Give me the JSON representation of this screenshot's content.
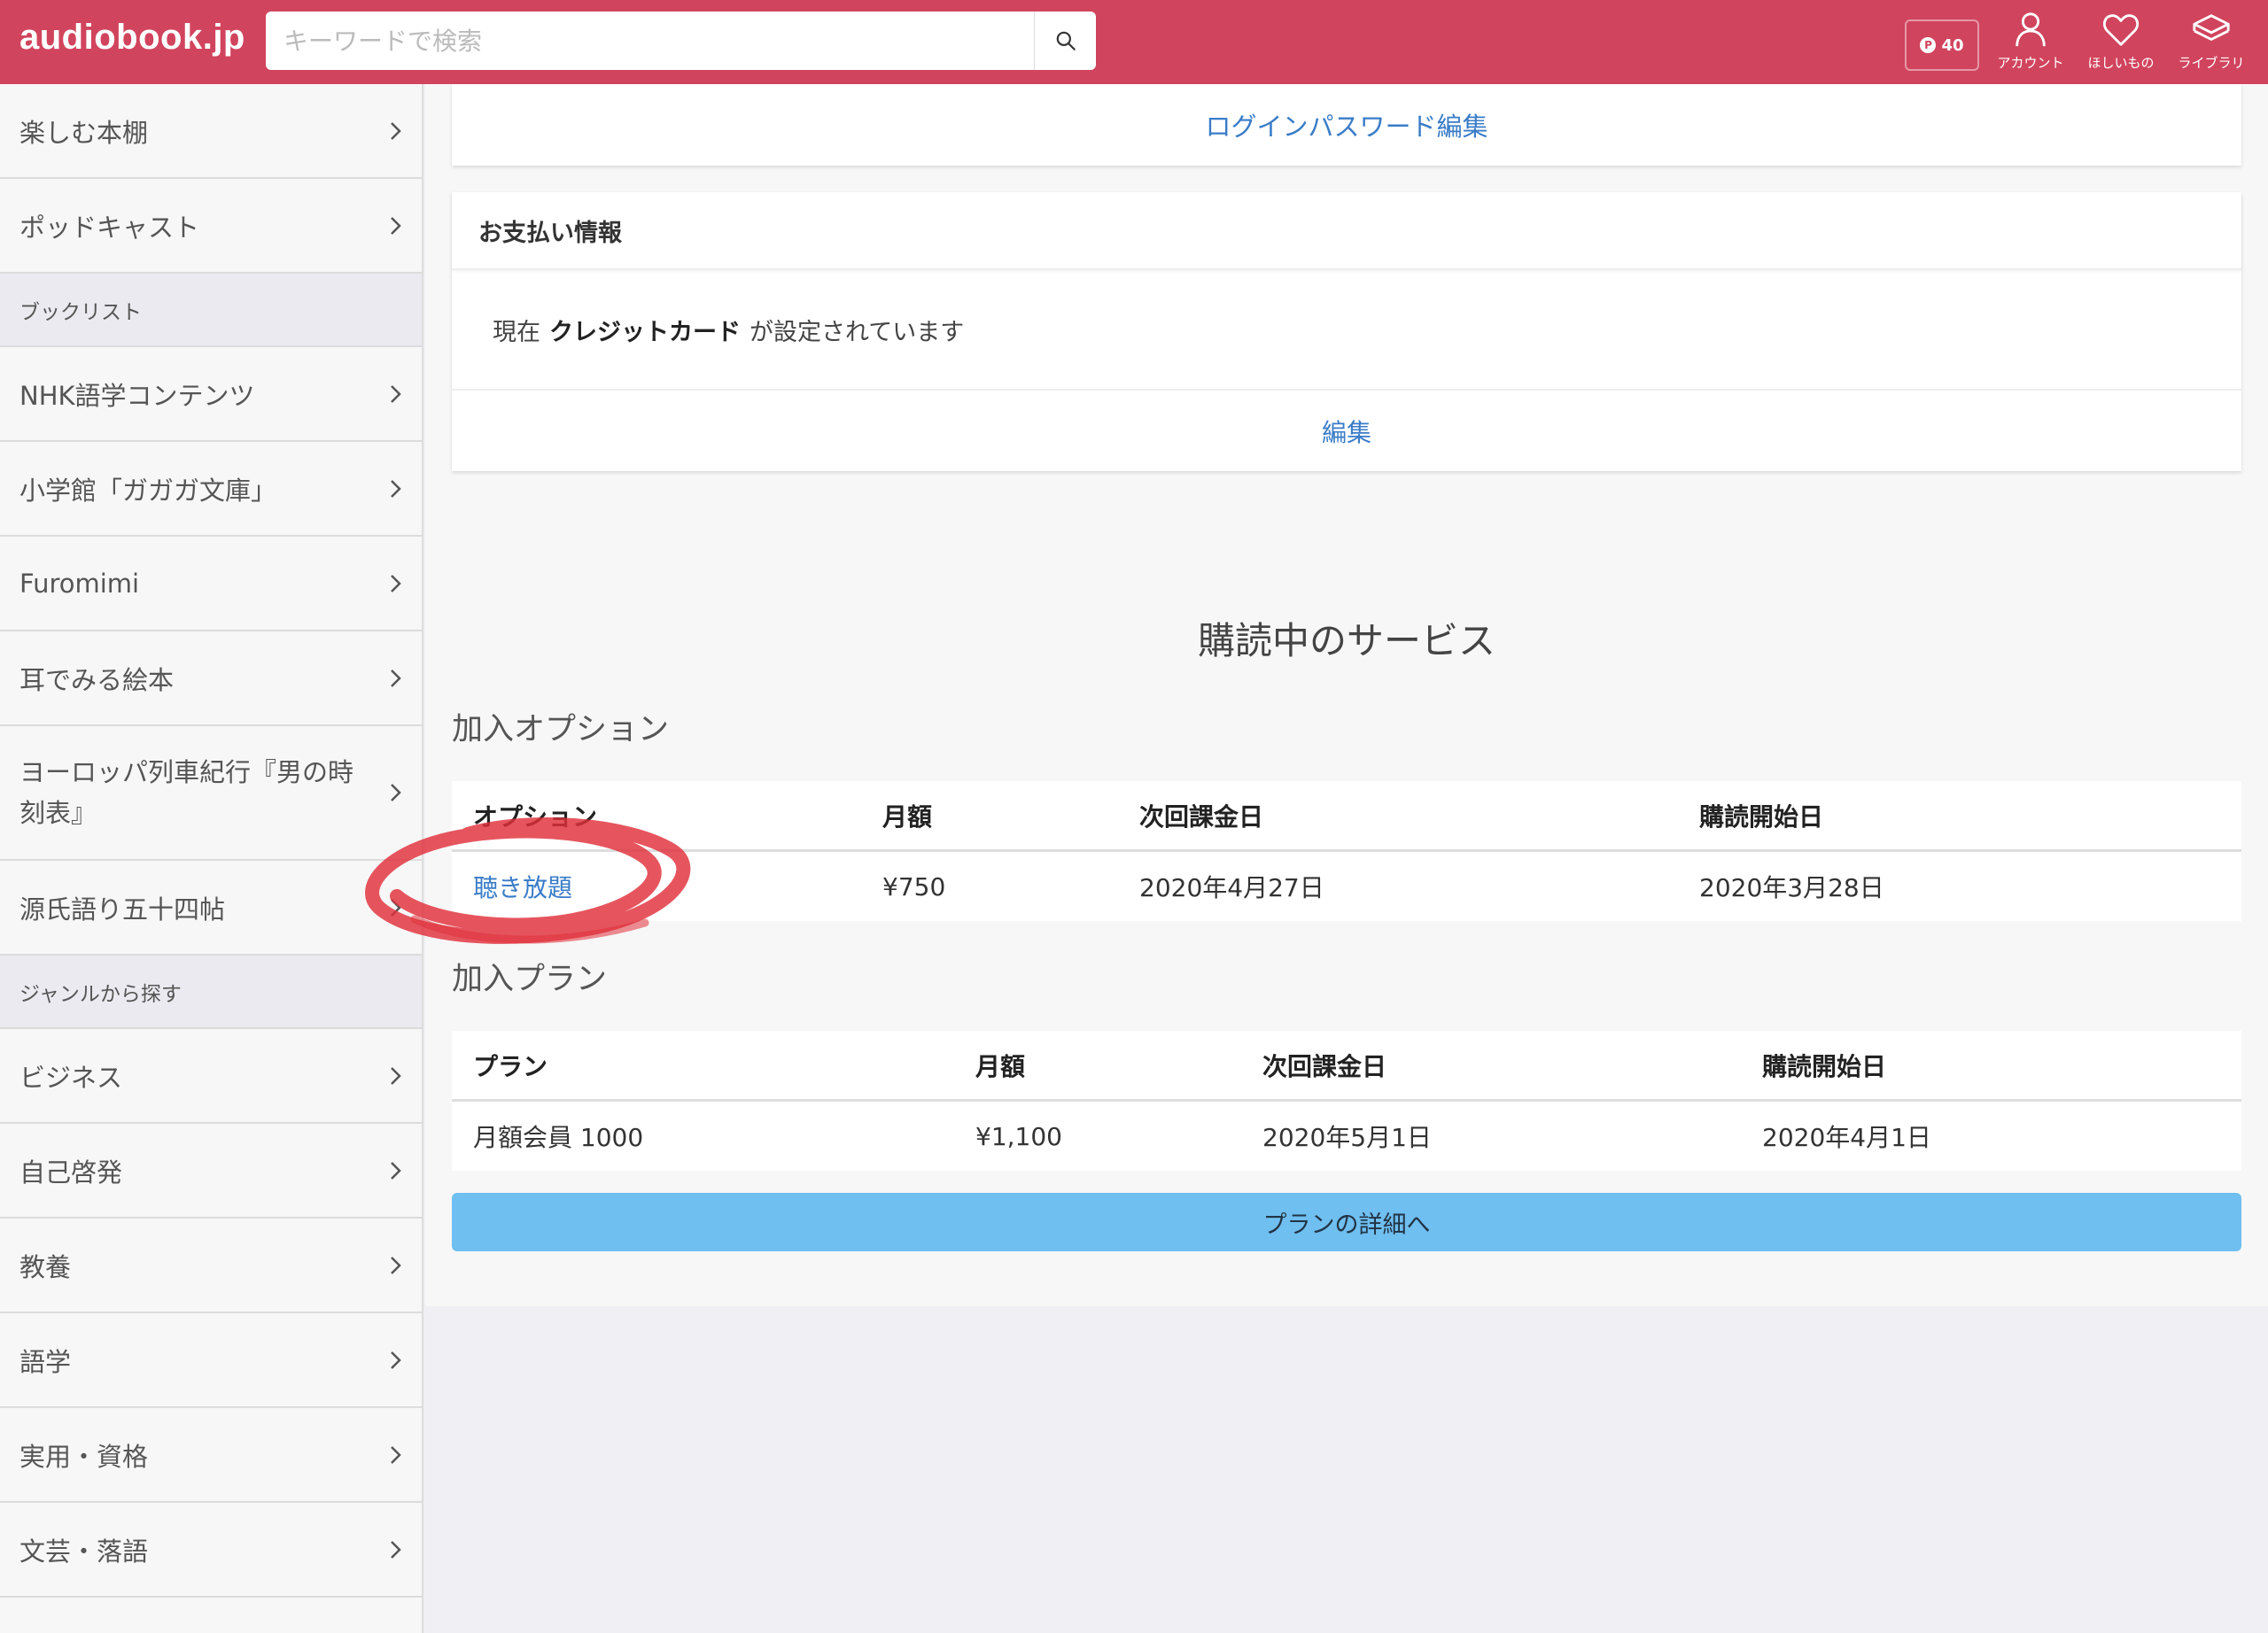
{
  "header": {
    "logo": "audiobook.jp",
    "search_placeholder": "キーワードで検索",
    "points": "40",
    "account_label": "アカウント",
    "wishlist_label": "ほしいもの",
    "library_label": "ライブラリ"
  },
  "sidebar": {
    "items_top": [
      {
        "label": "楽しむ本棚"
      },
      {
        "label": "ポッドキャスト"
      }
    ],
    "booklist_header": "ブックリスト",
    "booklist": [
      {
        "label": "NHK語学コンテンツ"
      },
      {
        "label": "小学館「ガガガ文庫」"
      },
      {
        "label": "Furomimi"
      },
      {
        "label": "耳でみる絵本"
      },
      {
        "label": "ヨーロッパ列車紀行『男の時刻表』"
      },
      {
        "label": "源氏語り五十四帖"
      }
    ],
    "genre_header": "ジャンルから探す",
    "genres": [
      {
        "label": "ビジネス"
      },
      {
        "label": "自己啓発"
      },
      {
        "label": "教養"
      },
      {
        "label": "語学"
      },
      {
        "label": "実用・資格"
      },
      {
        "label": "文芸・落語"
      }
    ]
  },
  "main": {
    "password_edit": "ログインパスワード編集",
    "payment": {
      "title": "お支払い情報",
      "prefix": "現在",
      "method": "クレジットカード",
      "suffix": "が設定されています",
      "edit": "編集"
    },
    "services_title": "購読中のサービス",
    "options": {
      "title": "加入オプション",
      "headers": [
        "オプション",
        "月額",
        "次回課金日",
        "購読開始日"
      ],
      "rows": [
        {
          "name": "聴き放題",
          "price": "¥750",
          "next": "2020年4月27日",
          "start": "2020年3月28日"
        }
      ]
    },
    "plans": {
      "title": "加入プラン",
      "headers": [
        "プラン",
        "月額",
        "次回課金日",
        "購読開始日"
      ],
      "rows": [
        {
          "name": "月額会員 1000",
          "price": "¥1,100",
          "next": "2020年5月1日",
          "start": "2020年4月1日"
        }
      ]
    },
    "plan_detail_button": "プランの詳細へ"
  },
  "colors": {
    "brand": "#d1445d",
    "link": "#3a7cc8",
    "button": "#6fbff0",
    "annotation": "#e0303a"
  }
}
